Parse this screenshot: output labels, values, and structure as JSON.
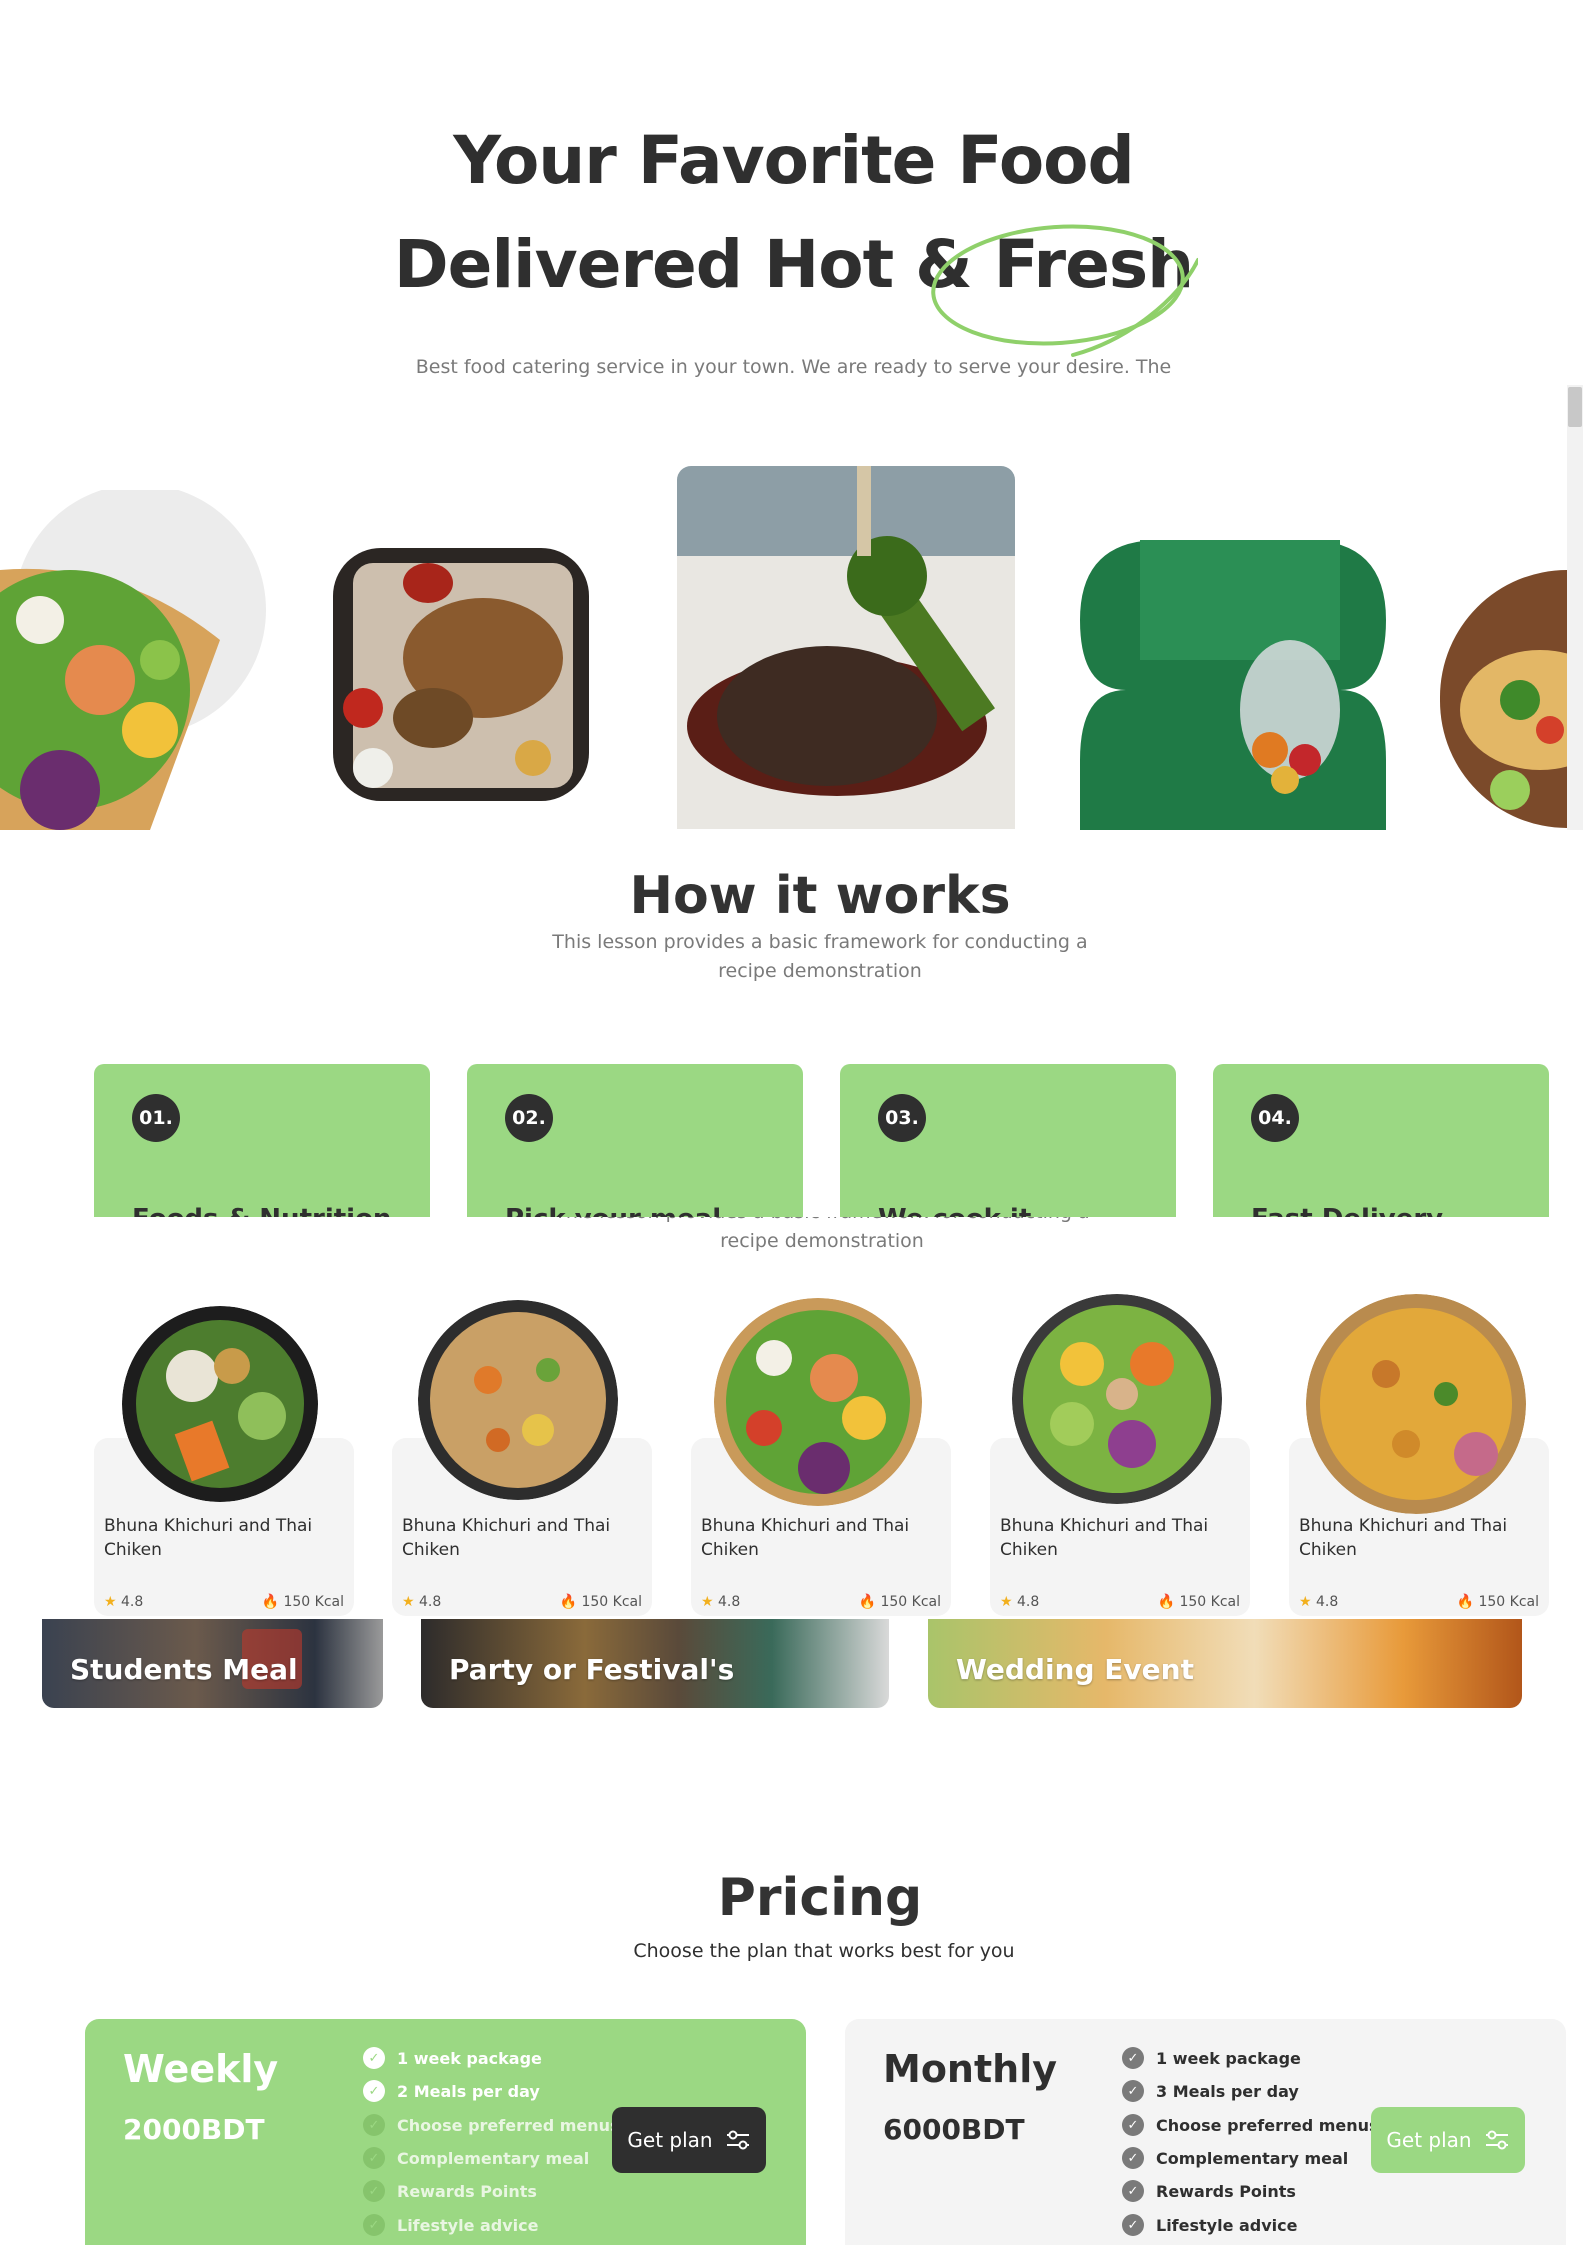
{
  "hero": {
    "title_line1": "Your Favorite Food",
    "title_line2_a": "Delivered Hot & ",
    "title_line2_b": "Fresh",
    "subtitle": "Best food catering service in your town. We are ready to serve your desire. The"
  },
  "how": {
    "title": "How it works",
    "subtitle_line1": "This lesson provides a basic framework for conducting a",
    "subtitle_line2": "recipe demonstration",
    "overlap_line1": "This lesson provides a basic framework for conducting a",
    "overlap_line2": "recipe demonstration",
    "steps": [
      {
        "num": "01.",
        "label": "Foods & Nutrition"
      },
      {
        "num": "02.",
        "label": "Pick your meal"
      },
      {
        "num": "03.",
        "label": "We cook it"
      },
      {
        "num": "04.",
        "label": "Fast Delivery"
      }
    ]
  },
  "meals": [
    {
      "name": "Bhuna Khichuri and Thai Chiken",
      "rating": "4.8",
      "kcal": "150 Kcal"
    },
    {
      "name": "Bhuna Khichuri and Thai Chiken",
      "rating": "4.8",
      "kcal": "150 Kcal"
    },
    {
      "name": "Bhuna Khichuri and Thai Chiken",
      "rating": "4.8",
      "kcal": "150 Kcal"
    },
    {
      "name": "Bhuna Khichuri and Thai Chiken",
      "rating": "4.8",
      "kcal": "150 Kcal"
    },
    {
      "name": "Bhuna Khichuri and Thai Chiken",
      "rating": "4.8",
      "kcal": "150 Kcal"
    }
  ],
  "events": [
    {
      "label": "Students Meal"
    },
    {
      "label": "Party or Festival's"
    },
    {
      "label": "Wedding Event"
    }
  ],
  "pricing": {
    "title": "Pricing",
    "subtitle": "Choose the plan that works best for you",
    "plans": [
      {
        "name": "Weekly",
        "price": "2000BDT",
        "button": "Get plan",
        "features": [
          "1 week package",
          "2 Meals per day",
          "Choose preferred menus",
          "Complementary meal",
          "Rewards Points",
          "Lifestyle advice"
        ],
        "included_count": 2
      },
      {
        "name": "Monthly",
        "price": "6000BDT",
        "button": "Get plan",
        "features": [
          "1 week package",
          "3 Meals per day",
          "Choose preferred menus",
          "Complementary meal",
          "Rewards Points",
          "Lifestyle advice"
        ],
        "included_count": 6
      }
    ]
  },
  "colors": {
    "accent_green": "#9bd883",
    "dark": "#2f2f2f",
    "card_gray": "#f4f4f4"
  }
}
